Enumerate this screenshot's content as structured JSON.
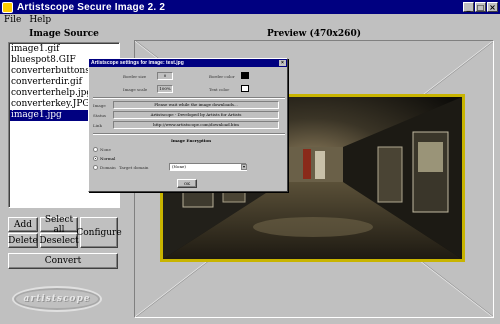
{
  "window": {
    "title": "Artistscope Secure Image 2. 2",
    "controls": [
      "_",
      "□",
      "×"
    ]
  },
  "menu": [
    "File",
    "Help"
  ],
  "image_source": {
    "title": "Image Source",
    "files": [
      "image1.gif",
      "bluespot8.GIF",
      "converterbuttons.gif",
      "converterdir.gif",
      "converterhelp.jpg",
      "converterkey.JPG",
      "image1.jpg"
    ],
    "selected_index": 6
  },
  "buttons": {
    "add": "Add",
    "select_all": "Select all",
    "delete": "Delete",
    "deselect": "Deselect",
    "configure": "Configure",
    "convert": "Convert"
  },
  "logo_text": "artistscope",
  "preview": {
    "title": "Preview (470x260)"
  },
  "dialog": {
    "title": "Artistscope settings for image: test.jpg",
    "close": "×",
    "border_size_label": "Border size",
    "border_size_value": "0",
    "border_color_label": "Border color",
    "border_color": "#000000",
    "image_scale_label": "Image scale",
    "image_scale_value": "100%",
    "text_color_label": "Text color",
    "text_color": "#ffffff",
    "image_label": "Image",
    "image_value": "Please wait while the image downloads...",
    "status_label": "Status",
    "status_value": "Artistscope - Developed by Artists for Artists",
    "link_label": "Link",
    "link_value": "http://www.artistscope.com/download.htm",
    "encryption_title": "Image Encryption",
    "radio_none": "None",
    "radio_normal": "Normal",
    "radio_domain": "Domain",
    "target_domain_label": "Target domain",
    "target_domain_value": "(None)",
    "ok": "OK"
  }
}
